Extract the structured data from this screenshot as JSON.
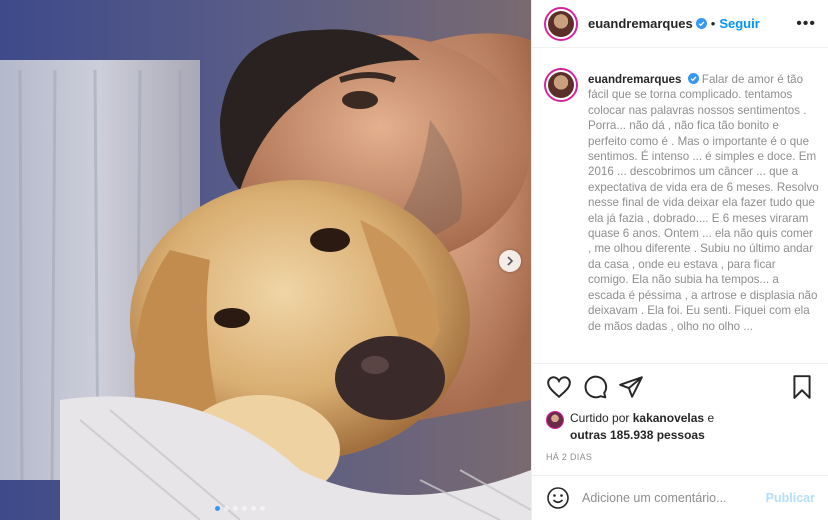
{
  "post": {
    "username": "euandremarques",
    "follow_label": "Seguir",
    "separator": "•",
    "more_label": "•••"
  },
  "caption": {
    "username": "euandremarques",
    "text": "Falar de amor é tão fácil que se torna complicado. tentamos colocar nas palavras nossos sentimentos . Porra... não dá , não fica tão bonito e perfeito como é . Mas o importante é o que sentimos. É intenso ... é simples e doce. Em 2016 ... descobrimos um câncer ... que a expectativa de vida era de 6 meses. Resolvo nesse final de vida deixar ela fazer tudo que ela já fazia , dobrado.... E 6 meses viraram quase 6 anos. Ontem ... ela não quis comer , me olhou diferente . Subiu no último andar da casa , onde eu estava , para ficar comigo. Ela não subia ha tempos... a escada é péssima , a artrose e displasia não deixavam . Ela foi. Eu senti. Fiquei com ela de mãos dadas , olho no olho ..."
  },
  "likes": {
    "prefix": "Curtido por",
    "user": "kakanovelas",
    "conj": "e",
    "others": "outras 185.938 pessoas"
  },
  "timestamp": "HÁ 2 DIAS",
  "comment": {
    "placeholder": "Adicione um comentário...",
    "publish_label": "Publicar"
  },
  "carousel": {
    "slide_count": 6,
    "active_index": 0
  },
  "icons": {
    "like": "heart-icon",
    "comment": "comment-icon",
    "share": "share-icon",
    "save": "bookmark-icon",
    "emoji": "emoji-icon",
    "next": "chevron-right-icon",
    "verified": "verified-badge-icon"
  },
  "colors": {
    "link_blue": "#0095f6",
    "publish_disabled": "#b2dffc",
    "muted": "#8e8e8e",
    "text": "#262626"
  }
}
